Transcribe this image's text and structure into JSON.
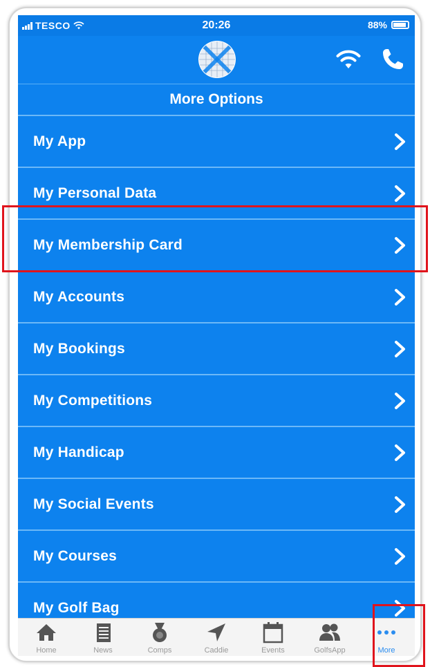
{
  "status_bar": {
    "carrier": "TESCO",
    "time": "20:26",
    "battery": "88%"
  },
  "header": {
    "title": "More Options",
    "logo_icon": "scotland-saltire-golf-ball-icon",
    "wifi_icon": "wifi-icon",
    "phone_icon": "phone-icon"
  },
  "menu": {
    "items": [
      {
        "label": "My App"
      },
      {
        "label": "My Personal Data"
      },
      {
        "label": "My Membership Card",
        "highlighted": true
      },
      {
        "label": "My Accounts"
      },
      {
        "label": "My Bookings"
      },
      {
        "label": "My Competitions"
      },
      {
        "label": "My Handicap"
      },
      {
        "label": "My Social Events"
      },
      {
        "label": "My Courses"
      },
      {
        "label": "My Golf Bag"
      }
    ]
  },
  "tab_bar": {
    "tabs": [
      {
        "label": "Home",
        "icon": "home-icon"
      },
      {
        "label": "News",
        "icon": "news-icon"
      },
      {
        "label": "Comps",
        "icon": "medal-icon"
      },
      {
        "label": "Caddie",
        "icon": "navigation-arrow-icon"
      },
      {
        "label": "Events",
        "icon": "calendar-icon"
      },
      {
        "label": "GolfsApp",
        "icon": "people-icon"
      },
      {
        "label": "More",
        "icon": "more-dots-icon",
        "active": true
      }
    ]
  },
  "colors": {
    "primary_blue": "#0d82ee",
    "divider": "#6cb8f7",
    "highlight_red": "#e0141c",
    "tab_active": "#2a8df0",
    "tab_inactive": "#9a9a9a"
  }
}
